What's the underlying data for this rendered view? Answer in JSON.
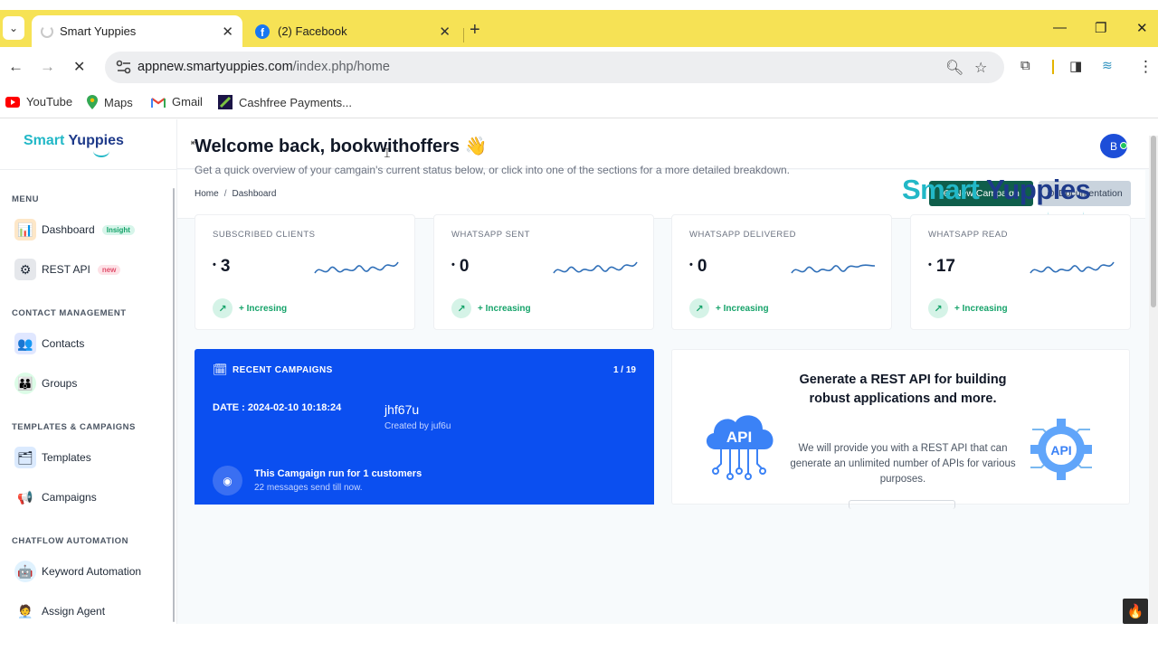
{
  "browser": {
    "tabs": [
      {
        "title": "Smart Yuppies",
        "active": true
      },
      {
        "title": "(2) Facebook",
        "active": false
      }
    ],
    "new_tab_symbol": "+",
    "url_host": "appnew.smartyuppies.com",
    "url_path": "/index.php/home",
    "bookmarks": [
      "YouTube",
      "Maps",
      "Gmail",
      "Cashfree Payments..."
    ]
  },
  "app": {
    "brand": {
      "part1": "Smart",
      "part2": "Yuppies"
    },
    "sidebar": {
      "sections": [
        {
          "title": "MENU"
        },
        {
          "title": "CONTACT MANAGEMENT"
        },
        {
          "title": "TEMPLATES & CAMPAIGNS"
        },
        {
          "title": "CHATFLOW AUTOMATION"
        }
      ],
      "items": [
        {
          "label": "Dashboard",
          "badge": "Insight"
        },
        {
          "label": "REST API",
          "badge": "new"
        },
        {
          "label": "Contacts"
        },
        {
          "label": "Groups"
        },
        {
          "label": "Templates"
        },
        {
          "label": "Campaigns"
        },
        {
          "label": "Keyword Automation"
        },
        {
          "label": "Assign Agent"
        }
      ]
    },
    "avatar_initial": "B",
    "breadcrumb": {
      "home": "Home",
      "separator": "/",
      "current": "Dashboard"
    },
    "buttons": {
      "new_campaign": "New Campaign",
      "documentation": "Documentation"
    },
    "welcome": "Welcome back, bookwithoffers",
    "welcome_emoji": "👋",
    "subtitle": "Get a quick overview of your camgain's current status below, or click into one of the sections for a more detailed breakdown.",
    "stats": [
      {
        "title": "SUBSCRIBED CLIENTS",
        "value": "3",
        "trend": "+ Incresing"
      },
      {
        "title": "WHATSAPP SENT",
        "value": "0",
        "trend": "+ Increasing"
      },
      {
        "title": "WHATSAPP DELIVERED",
        "value": "0",
        "trend": "+ Increasing"
      },
      {
        "title": "WHATSAPP READ",
        "value": "17",
        "trend": "+ Increasing"
      }
    ],
    "recent": {
      "title": "RECENT CAMPAIGNS",
      "pager": "1 / 19",
      "date": "DATE : 2024-02-10 10:18:24",
      "name": "jhf67u",
      "created_by": "Created by juf6u",
      "run_text": "This Camgaign run for 1 customers",
      "messages": "22 messages send till now."
    },
    "api": {
      "title": "Generate a REST API for building robust applications and more.",
      "desc": "We will provide you with a REST API that can generate an unlimited number of APIs for various purposes.",
      "cloud_label": "API",
      "gear_label": "API"
    },
    "colors": {
      "primary": "#0f5e4b",
      "campaign_blue": "#0b4ff0",
      "brand_teal": "#22b8c7",
      "brand_navy": "#1e3a8a",
      "tab_bar": "#f6e255"
    }
  }
}
